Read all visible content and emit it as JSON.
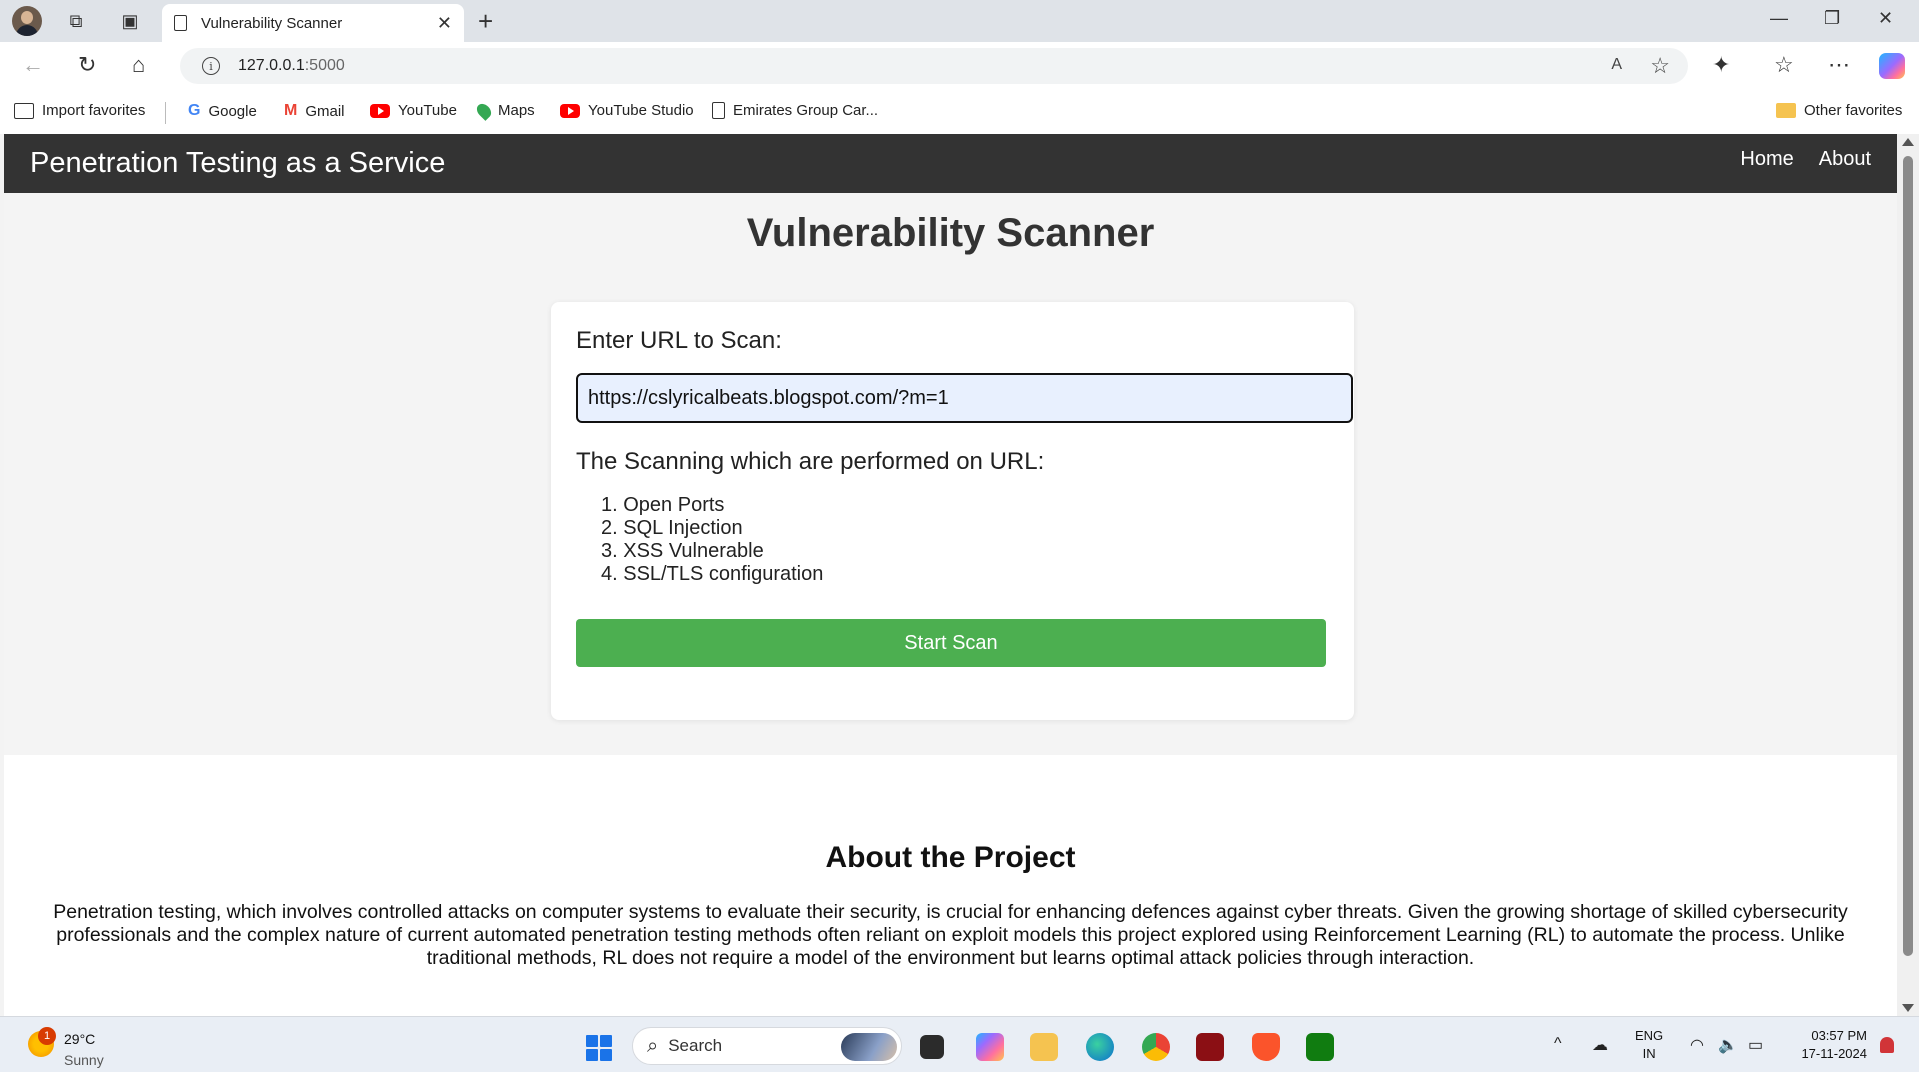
{
  "browser": {
    "tab_title": "Vulnerability Scanner",
    "address_host": "127.0.0.1",
    "address_port": ":5000",
    "favorites": [
      {
        "label": "Import favorites"
      },
      {
        "label": "Google"
      },
      {
        "label": "Gmail"
      },
      {
        "label": "YouTube"
      },
      {
        "label": "Maps"
      },
      {
        "label": "YouTube Studio"
      },
      {
        "label": "Emirates Group Car..."
      }
    ],
    "other_favorites": "Other favorites"
  },
  "site": {
    "brand": "Penetration Testing as a Service",
    "nav": [
      {
        "label": "Home"
      },
      {
        "label": "About"
      }
    ]
  },
  "scanner": {
    "title": "Vulnerability Scanner",
    "url_label": "Enter URL to Scan:",
    "url_value": "https://cslyricalbeats.blogspot.com/?m=1",
    "scans_heading": "The Scanning which are performed on URL:",
    "scans": [
      {
        "num": "1.",
        "label": "Open Ports"
      },
      {
        "num": "2.",
        "label": "SQL Injection"
      },
      {
        "num": "3.",
        "label": "XSS Vulnerable"
      },
      {
        "num": "4.",
        "label": "SSL/TLS configuration"
      }
    ],
    "button_label": "Start Scan",
    "button_color": "#4caf50"
  },
  "about": {
    "title": "About the Project",
    "text": "Penetration testing, which involves controlled attacks on computer systems to evaluate their security, is crucial for enhancing defences against cyber threats. Given the growing shortage of skilled cybersecurity professionals and the complex nature of current automated penetration testing methods often reliant on exploit models this project explored using Reinforcement Learning (RL) to automate the process. Unlike traditional methods, RL does not require a model of the environment but learns optimal attack policies through interaction."
  },
  "taskbar": {
    "weather_badge": "1",
    "weather_temp": "29°C",
    "weather_desc": "Sunny",
    "search_placeholder": "Search",
    "lang_line1": "ENG",
    "lang_line2": "IN",
    "time": "03:57 PM",
    "date": "17-11-2024"
  }
}
